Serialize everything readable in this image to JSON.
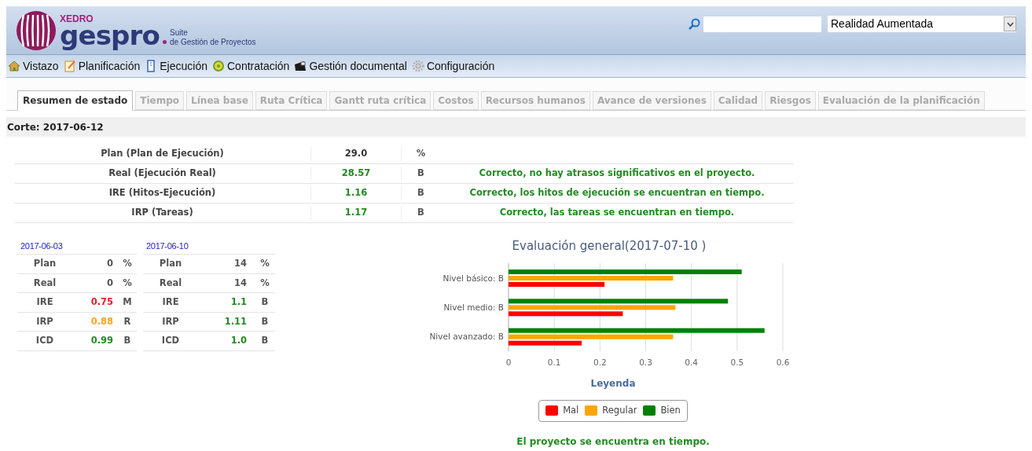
{
  "logo": {
    "brand": "XEDRO",
    "name": "gespro",
    "suite": "Suite",
    "tagline": "de Gestión de Proyectos"
  },
  "project_select": {
    "value": "Realidad Aumentada"
  },
  "menu": [
    {
      "label": "Vistazo"
    },
    {
      "label": "Planificación"
    },
    {
      "label": "Ejecución"
    },
    {
      "label": "Contratación"
    },
    {
      "label": "Gestión documental"
    },
    {
      "label": "Configuración"
    }
  ],
  "tabs": [
    {
      "label": "Resumen de estado",
      "selected": true
    },
    {
      "label": "Tiempo",
      "selected": false
    },
    {
      "label": "Línea base",
      "selected": false
    },
    {
      "label": "Ruta Crítica",
      "selected": false
    },
    {
      "label": "Gantt ruta crítica",
      "selected": false
    },
    {
      "label": "Costos",
      "selected": false
    },
    {
      "label": "Recursos humanos",
      "selected": false
    },
    {
      "label": "Avance de versiones",
      "selected": false
    },
    {
      "label": "Calidad",
      "selected": false
    },
    {
      "label": "Riesgos",
      "selected": false
    },
    {
      "label": "Evaluación de la planificación",
      "selected": false
    }
  ],
  "cut_date": "Corte: 2017-06-12",
  "summary_rows": [
    {
      "label": "Plan (Plan de Ejecución)",
      "value": "29.0",
      "color": "#333333",
      "grade": "%"
    },
    {
      "label": "Real (Ejecución Real)",
      "value": "28.57",
      "color": "#228b22",
      "grade": "B",
      "message": "Correcto, no hay atrasos significativos en el proyecto."
    },
    {
      "label": "IRE (Hitos-Ejecución)",
      "value": "1.16",
      "color": "#228b22",
      "grade": "B",
      "message": "Correcto, los hitos de ejecución se encuentran en tiempo."
    },
    {
      "label": "IRP (Tareas)",
      "value": "1.17",
      "color": "#228b22",
      "grade": "B",
      "message": "Correcto, las tareas se encuentran en tiempo."
    }
  ],
  "weekly_tables": [
    {
      "date": "2017-06-03",
      "rows": [
        {
          "label": "Plan",
          "value": "0",
          "color": "#555555",
          "unit": "%"
        },
        {
          "label": "Real",
          "value": "0",
          "color": "#555555",
          "unit": "%"
        },
        {
          "label": "IRE",
          "value": "0.75",
          "color": "#e8202a",
          "unit": "M"
        },
        {
          "label": "IRP",
          "value": "0.88",
          "color": "#f5a623",
          "unit": "R"
        },
        {
          "label": "ICD",
          "value": "0.99",
          "color": "#228b22",
          "unit": "B"
        }
      ]
    },
    {
      "date": "2017-06-10",
      "rows": [
        {
          "label": "Plan",
          "value": "14",
          "color": "#555555",
          "unit": "%"
        },
        {
          "label": "Real",
          "value": "14",
          "color": "#555555",
          "unit": "%"
        },
        {
          "label": "IRE",
          "value": "1.1",
          "color": "#228b22",
          "unit": "B"
        },
        {
          "label": "IRP",
          "value": "1.11",
          "color": "#228b22",
          "unit": "B"
        },
        {
          "label": "ICD",
          "value": "1.0",
          "color": "#228b22",
          "unit": "B"
        }
      ]
    }
  ],
  "evaluation": {
    "chart_data": {
      "type": "bar",
      "orientation": "horizontal",
      "title": "Evaluación general(2017-07-10 )",
      "xlabel": "Leyenda",
      "categories": [
        "Nivel básico: B",
        "Nivel medio: B",
        "Nivel avanzado: B"
      ],
      "xlim": [
        0,
        0.6
      ],
      "grid": true,
      "xticks": [
        0,
        0.1,
        0.2,
        0.3,
        0.4,
        0.5,
        0.6
      ],
      "series": [
        {
          "name": "Mal",
          "color": "#ff0000",
          "values": [
            0.21,
            0.25,
            0.16
          ]
        },
        {
          "name": "Regular",
          "color": "#ffa500",
          "values": [
            0.36,
            0.365,
            0.36
          ]
        },
        {
          "name": "Bien",
          "color": "#008000",
          "values": [
            0.51,
            0.48,
            0.56
          ]
        }
      ]
    },
    "status": "El proyecto se encuentra en tiempo."
  }
}
